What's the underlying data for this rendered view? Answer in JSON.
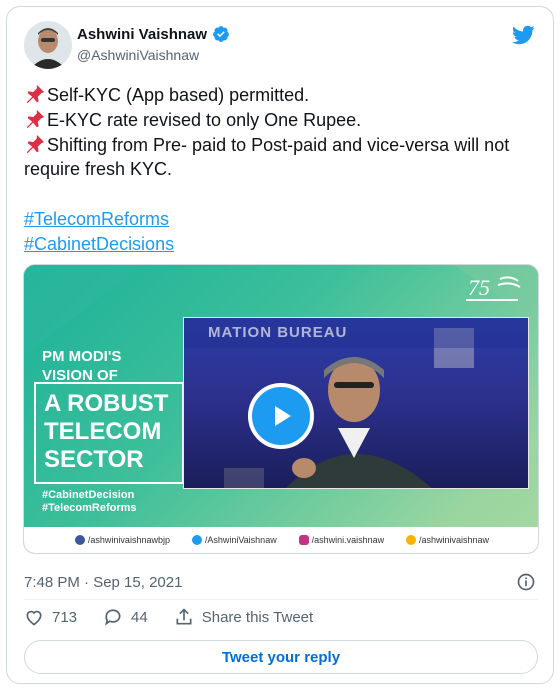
{
  "author": {
    "name": "Ashwini Vaishnaw",
    "handle": "@AshwiniVaishnaw"
  },
  "tweet": {
    "lines": [
      "Self-KYC (App based) permitted.",
      "E-KYC rate revised to only One Rupee.",
      "Shifting from Pre- paid to Post-paid and vice-versa will not require fresh KYC."
    ],
    "hashtags": [
      "#TelecomReforms",
      "#CabinetDecisions"
    ]
  },
  "media": {
    "headline_top": "PM MODI'S VISION OF",
    "headline_box": "A ROBUST TELECOM SECTOR",
    "small_tags": [
      "#CabinetDecision",
      "#TelecomReforms"
    ],
    "video_banner": "MATION BUREAU",
    "footer_handles": [
      "/ashwinivaishnawbjp",
      "/AshwiniVaishnaw",
      "/ashwini.vaishnaw",
      "/ashwinivaishnaw"
    ]
  },
  "meta": {
    "timestamp": "7:48 PM · Sep 15, 2021"
  },
  "actions": {
    "likes": "713",
    "replies": "44",
    "share_label": "Share this Tweet"
  },
  "reply_button": "Tweet your reply",
  "colors": {
    "accent": "#1d9bf0",
    "text": "#0f1419",
    "secondary": "#536471"
  }
}
